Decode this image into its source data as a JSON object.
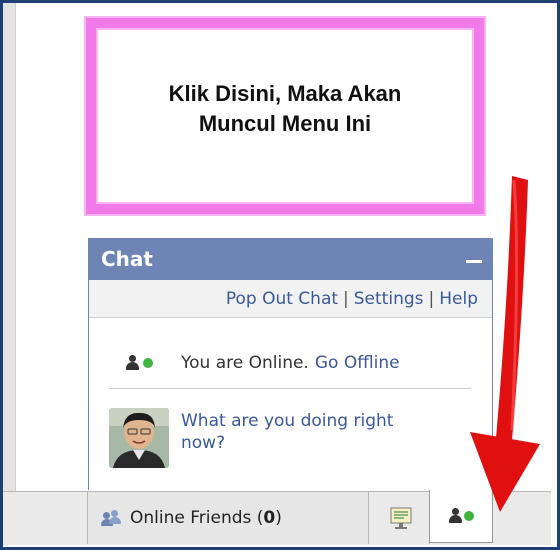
{
  "callout": {
    "text_line1": "Klik Disini, Maka Akan",
    "text_line2": "Muncul Menu Ini"
  },
  "chat": {
    "title": "Chat",
    "links": {
      "pop_out": "Pop Out Chat",
      "separator": "|",
      "settings": "Settings",
      "help": "Help"
    },
    "status_online": "You are Online.",
    "go_offline": "Go Offline",
    "status_prompt": "What are you doing right now?"
  },
  "bottom_bar": {
    "online_friends_label": "Online Friends (",
    "online_friends_count": "0",
    "online_friends_close": ")"
  },
  "colors": {
    "chat_header": "#6d84b4",
    "link": "#3b5998",
    "callout_border": "#f07ae8",
    "arrow": "#e01010",
    "online": "#3fb43f",
    "frame": "#1e3f73"
  },
  "icons": [
    "minimize-icon",
    "person-icon",
    "online-dot-icon",
    "friends-icon",
    "presence-icon",
    "chat-person-icon",
    "arrow-annotation"
  ]
}
